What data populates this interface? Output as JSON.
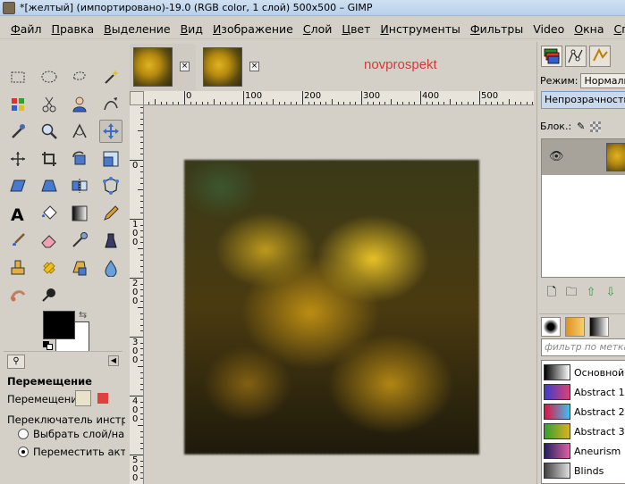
{
  "window": {
    "title": "*[желтый] (импортировано)-19.0 (RGB color, 1 слой) 500x500 – GIMP"
  },
  "menubar": [
    {
      "label": "Файл",
      "ul": "Ф",
      "rest": "айл"
    },
    {
      "label": "Правка",
      "ul": "П",
      "rest": "равка"
    },
    {
      "label": "Выделение",
      "ul": "В",
      "rest": "ыделение"
    },
    {
      "label": "Вид",
      "ul": "В",
      "rest": "ид"
    },
    {
      "label": "Изображение",
      "ul": "И",
      "rest": "зображение"
    },
    {
      "label": "Слой",
      "ul": "С",
      "rest": "лой"
    },
    {
      "label": "Цвет",
      "ul": "Ц",
      "rest": "вет"
    },
    {
      "label": "Инструменты",
      "ul": "И",
      "rest": "нструменты"
    },
    {
      "label": "Фильтры",
      "ul": "Ф",
      "rest": "ильтры"
    },
    {
      "label": "Video",
      "ul": "",
      "rest": "Video"
    },
    {
      "label": "Окна",
      "ul": "О",
      "rest": "кна"
    },
    {
      "label": "Справка",
      "ul": "С",
      "rest": "правка"
    }
  ],
  "toolbox": {
    "tools": [
      "rect-select",
      "ellipse-select",
      "free-select",
      "fuzzy-select",
      "color-select",
      "scissors-select",
      "foreground-select",
      "paths",
      "color-picker",
      "zoom",
      "measure",
      "move",
      "align",
      "crop",
      "rotate",
      "scale",
      "shear",
      "perspective",
      "flip",
      "cage",
      "text",
      "bucket-fill",
      "blend",
      "pencil",
      "paintbrush",
      "eraser",
      "airbrush",
      "ink",
      "clone",
      "heal",
      "perspective-clone",
      "smudge",
      "blur",
      "dodge-burn"
    ],
    "active_tool": "move",
    "fg_color": "#000000",
    "bg_color": "#ffffff"
  },
  "tool_options": {
    "title": "Перемещение",
    "move_label": "Перемещение:",
    "switch_label": "Переключатель инструме",
    "radio_1": "Выбрать слой/напра",
    "radio_2": "Переместить активн",
    "selected_radio": 2
  },
  "image_tabs": {
    "watermark": "novprospekt"
  },
  "rulers": {
    "h_labels": [
      "0",
      "100",
      "200",
      "300",
      "400",
      "500"
    ],
    "v_labels": [
      "0",
      "100",
      "200",
      "300",
      "400",
      "500"
    ]
  },
  "layers_panel": {
    "mode_label": "Режим:",
    "mode_value": "Нормальный",
    "opacity_label": "Непрозрачность",
    "lock_label": "Блок.:"
  },
  "gradients": {
    "filter_placeholder": "фильтр по меткам",
    "items": [
      {
        "name": "Основной в",
        "c1": "#000000",
        "c2": "#ffffff"
      },
      {
        "name": "Abstract 1",
        "c1": "#3a3ad0",
        "c2": "#e04070"
      },
      {
        "name": "Abstract 2",
        "c1": "#e01040",
        "c2": "#40c0f0"
      },
      {
        "name": "Abstract 3",
        "c1": "#30a030",
        "c2": "#e0b020"
      },
      {
        "name": "Aneurism",
        "c1": "#202060",
        "c2": "#e060a0"
      },
      {
        "name": "Blinds",
        "c1": "#404040",
        "c2": "#e0e0e0"
      }
    ]
  }
}
